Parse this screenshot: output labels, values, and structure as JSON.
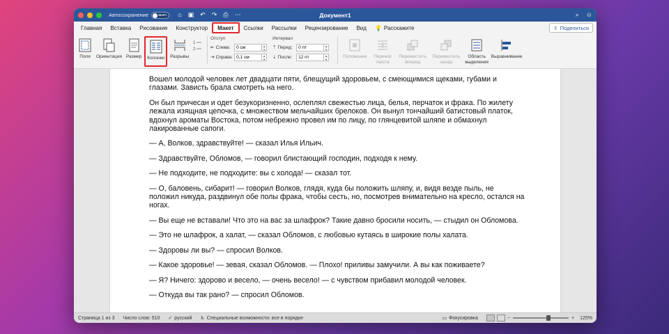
{
  "window": {
    "title": "Документ1",
    "autosave_label": "Автосохранение",
    "autosave_state": "выкл.",
    "colors": {
      "titlebar": "#2b579a",
      "highlight": "#e3262a"
    }
  },
  "tabs": [
    {
      "label": "Главная",
      "active": false
    },
    {
      "label": "Вставка",
      "active": false
    },
    {
      "label": "Рисование",
      "active": false
    },
    {
      "label": "Конструктор",
      "active": false
    },
    {
      "label": "Макет",
      "active": true
    },
    {
      "label": "Ссылки",
      "active": false
    },
    {
      "label": "Рассылки",
      "active": false
    },
    {
      "label": "Рецензирование",
      "active": false
    },
    {
      "label": "Вид",
      "active": false
    }
  ],
  "tell_me": "Расскажите",
  "share_label": "Поделиться",
  "ribbon": {
    "fields": "Поля",
    "orientation": "Ориентация",
    "size": "Размер",
    "columns": "Колонки",
    "breaks": "Разрывы",
    "indent": {
      "header": "Отступ",
      "left_label": "Слева:",
      "left_value": "0 см",
      "right_label": "Справа:",
      "right_value": "0,1 см"
    },
    "spacing": {
      "header": "Интервал",
      "before_label": "Перед:",
      "before_value": "0 пт",
      "after_label": "После:",
      "after_value": "12 пт"
    },
    "position": "Положение",
    "wrap": "Перенос текста",
    "forward": "Переместить вперед",
    "backward": "Переместить назад",
    "selection": "Область выделения",
    "align": "Выравнивание"
  },
  "document": {
    "paragraphs": [
      "Вошел молодой человек лет двадцати пяти, блещущий здоровьем, с смеющимися щеками, губами и глазами. Зависть брала смотреть на него.",
      "Он был причесан и одет безукоризненно, ослеплял свежестью лица, белья, перчаток и фрака. По жилету лежала изящная цепочка, с множеством мельчайших брелоков. Он вынул тончайший батистовый платок, вдохнул ароматы Востока, потом небрежно провел им по лицу, по глянцевитой шляпе и обмахнул лакированные сапоги.",
      "— А, Волков, здравствуйте! — сказал Илья Ильич.",
      "— Здравствуйте, Обломов, — говорил блистающий господин, подходя к нему.",
      "— Не подходите, не подходите: вы с холода! — сказал тот.",
      "— О, баловень, сибарит! — говорил Волков, глядя, куда бы положить шляпу, и, видя везде пыль, не положил никуда, раздвинул обе полы фрака, чтобы сесть, но, посмотрев внимательно на кресло, остался на ногах.",
      "— Вы еще не вставали! Что это на вас за шлафрок? Такие давно бросили носить, — стыдил он Обломова.",
      "— Это не шлафрок, а халат, — сказал Обломов, с любовью кутаясь в широкие полы халата.",
      "— Здоровы ли вы? — спросил Волков.",
      "— Какое здоровье! — зевая, сказал Обломов. — Плохо! приливы замучили. А вы как поживаете?",
      "— Я? Ничего: здорово и весело, — очень весело! — с чувством прибавил молодой человек.",
      "— Откуда вы так рано? — спросил Обломов."
    ]
  },
  "statusbar": {
    "page": "Страница 1 из 3",
    "words": "Число слов: 510",
    "language": "русский",
    "accessibility": "Специальные возможности: все в порядке",
    "focus": "Фокусировка",
    "zoom": "125%"
  }
}
